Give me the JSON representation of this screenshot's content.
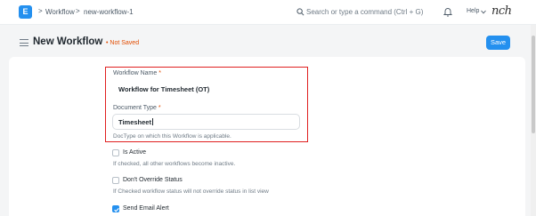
{
  "navbar": {
    "logo_letter": "E",
    "breadcrumbs": [
      "Workflow",
      "new-workflow-1"
    ],
    "separator": ">",
    "search_placeholder": "Search or type a command (Ctrl + G)",
    "help_label": "Help",
    "user_signature": "nch"
  },
  "header": {
    "title": "New Workflow",
    "status": "• Not Saved",
    "save_label": "Save"
  },
  "form": {
    "workflow_name": {
      "label": "Workflow Name",
      "required_mark": "*",
      "value": "Workflow for Timesheet (OT)"
    },
    "document_type": {
      "label": "Document Type",
      "required_mark": "*",
      "value": "Timesheet",
      "help": "DocType on which this Workflow is applicable."
    },
    "checkboxes": [
      {
        "label": "Is Active",
        "checked": false,
        "help": "If checked, all other workflows become inactive."
      },
      {
        "label": "Don't Override Status",
        "checked": false,
        "help": "If Checked workflow status will not override status in list view"
      },
      {
        "label": "Send Email Alert",
        "checked": true
      }
    ]
  },
  "colors": {
    "accent": "#2490ef",
    "unsaved": "#e24c00",
    "highlight": "#e02020"
  }
}
